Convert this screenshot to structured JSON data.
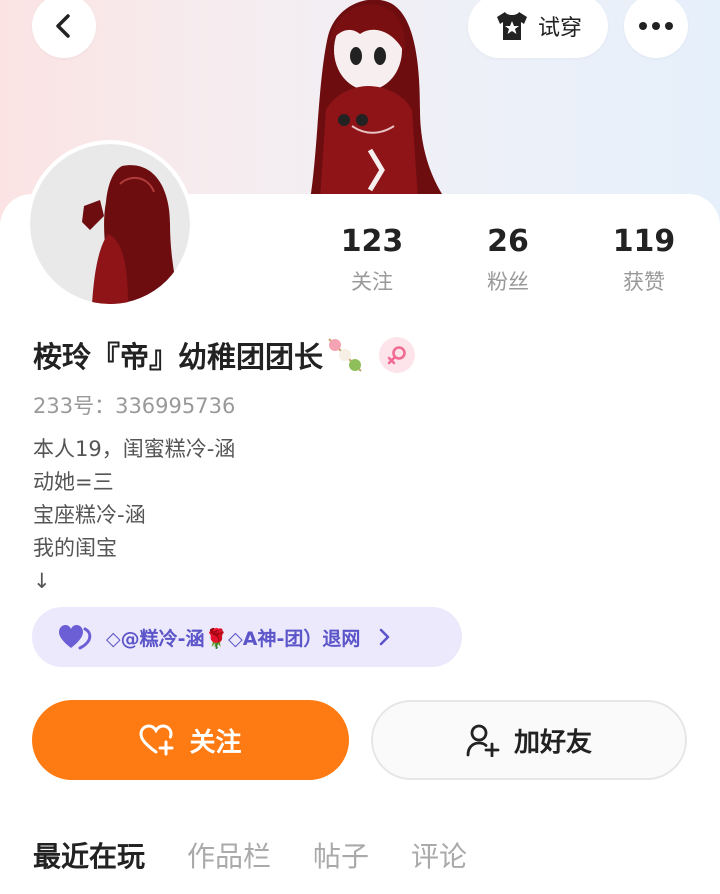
{
  "header": {
    "tryon_label": "试穿"
  },
  "stats": [
    {
      "value": "123",
      "label": "关注"
    },
    {
      "value": "26",
      "label": "粉丝"
    },
    {
      "value": "119",
      "label": "获赞"
    }
  ],
  "profile": {
    "name": "桉玲『帝』幼稚团团长",
    "uid": "233号：336995736",
    "bio": [
      "本人19，闺蜜糕冷-涵",
      "动她=三",
      "宝座糕冷-涵",
      "我的闺宝",
      "↓"
    ]
  },
  "group": {
    "text": "◇@糕冷-涵🌹◇A神-团）退网"
  },
  "actions": {
    "follow_label": "关注",
    "add_friend_label": "加好友"
  },
  "tabs": [
    "最近在玩",
    "作品栏",
    "帖子",
    "评论"
  ],
  "colors": {
    "accent_orange": "#fe7a12",
    "group_bg": "#ebe9fb",
    "group_text": "#5b55c9",
    "character_hair": "#7a0f12",
    "female_badge": "#f06a93"
  }
}
